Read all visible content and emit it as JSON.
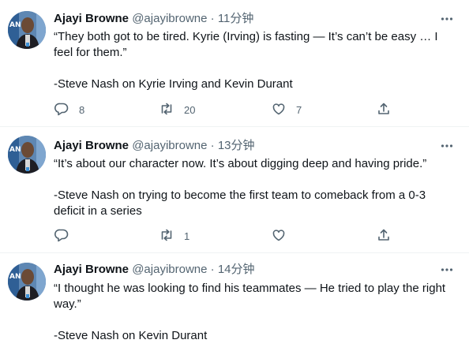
{
  "tweets": [
    {
      "name": "Ajayi Browne",
      "handle": "@ajayibrowne",
      "separator": "·",
      "time": "11分钟",
      "lines": [
        "“They both got to be tired. Kyrie (Irving) is fasting — It’s can’t be easy … I",
        "feel for them.”",
        "",
        "-Steve Nash on Kyrie Irving and Kevin Durant"
      ],
      "replies": "8",
      "retweets": "20",
      "likes": "7"
    },
    {
      "name": "Ajayi Browne",
      "handle": "@ajayibrowne",
      "separator": "·",
      "time": "13分钟",
      "lines": [
        "“It’s about our character now. It’s about digging deep and having pride.”",
        "",
        "-Steve Nash on trying to become the first team to comeback from a 0-3",
        "deficit in a series"
      ],
      "replies": "",
      "retweets": "1",
      "likes": ""
    },
    {
      "name": "Ajayi Browne",
      "handle": "@ajayibrowne",
      "separator": "·",
      "time": "14分钟",
      "lines": [
        "“I thought he was looking to find his teammates — He tried to play the right",
        "way.”",
        "",
        "-Steve Nash on Kevin Durant"
      ]
    }
  ],
  "colors": {
    "text": "#0f1419",
    "secondary": "#536471",
    "divider": "#eff3f4"
  },
  "icons": [
    "reply-icon",
    "retweet-icon",
    "like-icon",
    "share-icon",
    "more-icon"
  ]
}
